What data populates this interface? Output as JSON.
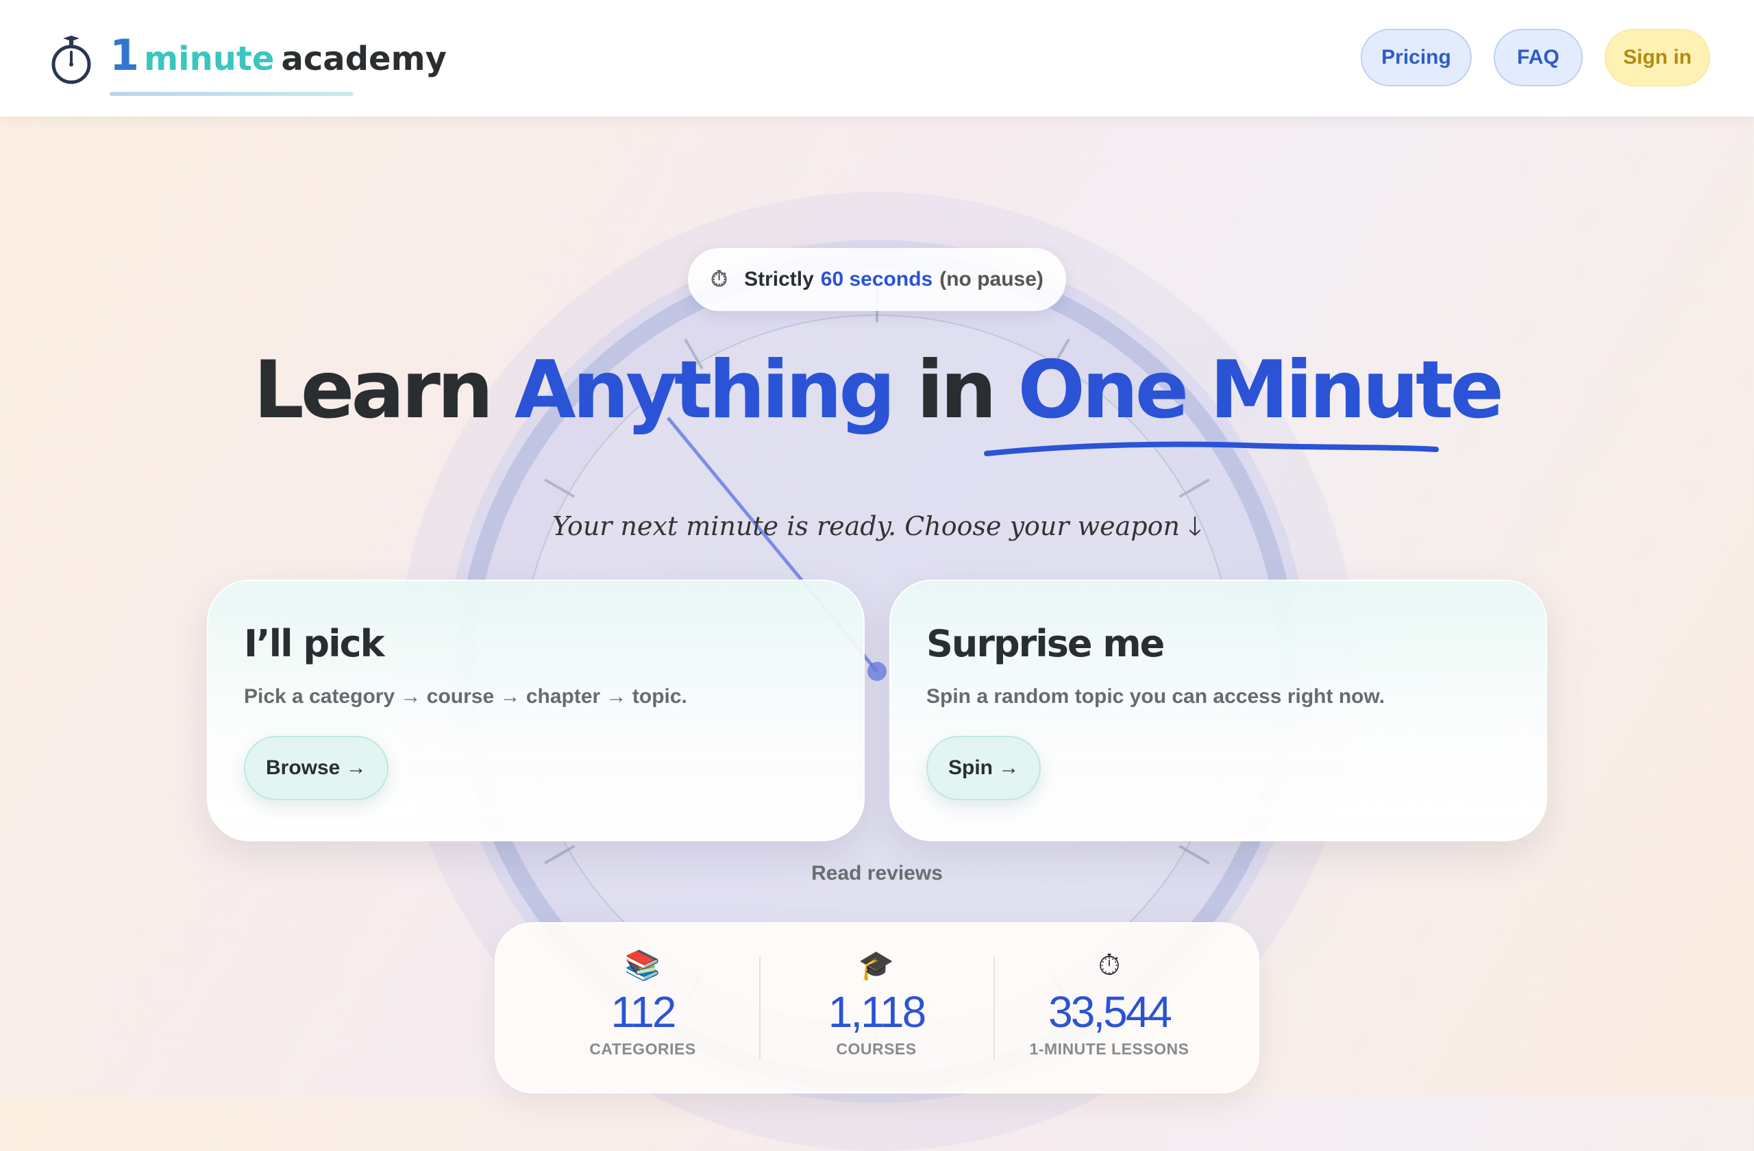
{
  "brand": {
    "number": "1",
    "word1": "minute",
    "word2": "academy"
  },
  "nav": {
    "pricing": "Pricing",
    "faq": "FAQ",
    "signin": "Sign in"
  },
  "badge": {
    "prefix": "Strictly",
    "highlight": "60 seconds",
    "suffix": "(no pause)"
  },
  "headline": {
    "part1": "Learn",
    "part2": "Anything",
    "part3": "in",
    "part4": "One Minute"
  },
  "tagline": "Your next minute is ready. Choose your weapon",
  "cards": {
    "pick": {
      "title": "I’ll pick",
      "description": "Pick a category → course → chapter → topic.",
      "button": "Browse →"
    },
    "surprise": {
      "title": "Surprise me",
      "description": "Spin a random topic you can access right now.",
      "button": "Spin →"
    }
  },
  "reviews_link": "Read reviews",
  "stats": [
    {
      "icon": "books-icon",
      "value": "112",
      "label": "CATEGORIES"
    },
    {
      "icon": "graduation-cap-icon",
      "value": "1,118",
      "label": "COURSES"
    },
    {
      "icon": "stopwatch-icon",
      "value": "33,544",
      "label": "1-MINUTE LESSONS"
    }
  ],
  "colors": {
    "accent_blue": "#2a53d6",
    "teal": "#3ac6c0",
    "signin_bg": "#fdf2b4"
  }
}
